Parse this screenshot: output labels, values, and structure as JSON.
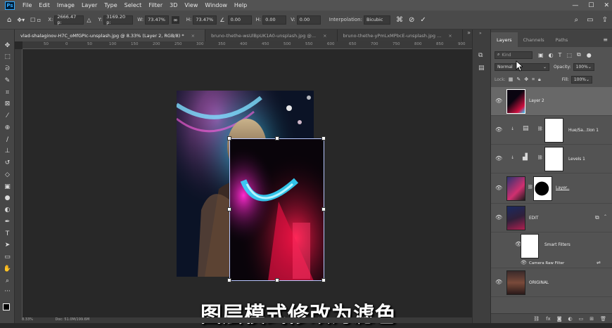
{
  "app": {
    "logo": "Ps"
  },
  "menu": [
    "File",
    "Edit",
    "Image",
    "Layer",
    "Type",
    "Select",
    "Filter",
    "3D",
    "View",
    "Window",
    "Help"
  ],
  "window_controls": {
    "minimize": "—",
    "maximize": "☐",
    "close": "✕"
  },
  "options": {
    "x_label": "X:",
    "x_value": "2666.47 p:",
    "y_label": "Y:",
    "y_value": "3169.20 p:",
    "w_label": "W:",
    "w_value": "73.47%",
    "h_label": "H:",
    "h_value": "73.47%",
    "angle_value": "0.00",
    "hskew_label": "H:",
    "hskew_value": "0.00",
    "vskew_label": "V:",
    "vskew_value": "0.00",
    "interp_label": "Interpolation:",
    "interp_value": "Bicubic"
  },
  "tabs": [
    {
      "label": "vlad-shalaginov-H7C_oMfGPIc-unsplash.jpg @ 8.33% (Layer 2, RGB/8) *",
      "close": "×",
      "active": true
    },
    {
      "label": "bruno-thethe-wsUlBpUK1A0-unsplash.jpg @...",
      "close": "×",
      "active": false
    },
    {
      "label": "bruno-thethe-yPmLxMPbcE-unsplash.jpg ...",
      "close": "×",
      "active": false
    }
  ],
  "tabs_more": "»",
  "ruler_ticks": [
    "50",
    "0",
    "50",
    "100",
    "150",
    "200",
    "250",
    "300",
    "350",
    "400",
    "450",
    "500",
    "550",
    "600",
    "650",
    "700",
    "750",
    "800",
    "850",
    "900"
  ],
  "subtitle": "图层模式修改为滤色",
  "status": {
    "zoom": "8.33%",
    "doc": "Doc: 51.0M/199.6M"
  },
  "layers_panel": {
    "tabs": [
      "Layers",
      "Channels",
      "Paths"
    ],
    "search_placeholder": "Kind",
    "blend_mode": "Normal",
    "opacity_label": "Opacity:",
    "opacity_value": "100%",
    "lock_label": "Lock:",
    "fill_label": "Fill:",
    "fill_value": "100%",
    "layers": [
      {
        "name": "Layer 2",
        "selected": true
      },
      {
        "name": "Hue/Sa...tion 1",
        "selected": false
      },
      {
        "name": "Levels 1",
        "selected": false
      },
      {
        "name": "Layer..",
        "selected": false
      },
      {
        "name": "EDIT",
        "selected": false
      },
      {
        "name": "Smart Filters",
        "selected": false
      },
      {
        "name": "Camera Raw Filter",
        "selected": false
      },
      {
        "name": "ORIGINAL",
        "selected": false
      }
    ]
  },
  "colors": {
    "menubar": "#535353",
    "panel": "#535353",
    "canvas_bg": "#282828",
    "ps_blue": "#31a8ff",
    "selected_layer": "#686868"
  }
}
